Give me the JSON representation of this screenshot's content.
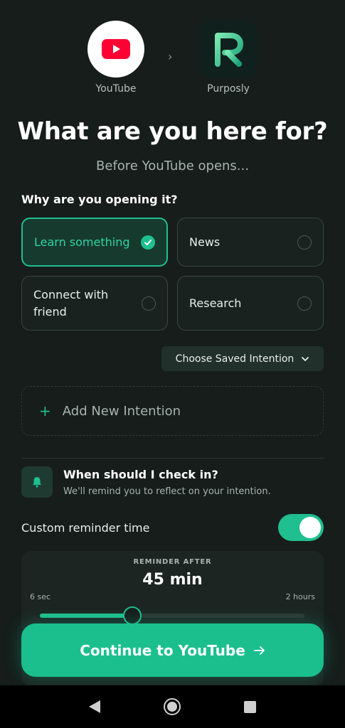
{
  "apps": {
    "source": {
      "label": "YouTube",
      "icon": "youtube-play-icon"
    },
    "separator_icon": "chevron-right-icon",
    "target": {
      "label": "Purposly",
      "icon": "purposly-logo"
    }
  },
  "title": "What are you here for?",
  "subtitle": "Before YouTube opens...",
  "question": "Why are you opening it?",
  "intentions": [
    {
      "label": "Learn something",
      "selected": true
    },
    {
      "label": "News",
      "selected": false
    },
    {
      "label": "Connect with friend",
      "selected": false
    },
    {
      "label": "Research",
      "selected": false
    }
  ],
  "saved_intention": {
    "label": "Choose Saved Intention",
    "icon": "chevron-down-icon"
  },
  "add_intention": {
    "label": "Add New Intention",
    "icon": "plus-icon"
  },
  "check_in": {
    "icon": "bell-icon",
    "title": "When should I check in?",
    "subtitle": "We'll remind you to reflect on your intention."
  },
  "custom_reminder": {
    "label": "Custom reminder time",
    "enabled": true
  },
  "reminder": {
    "label": "REMINDER AFTER",
    "value": "45 min",
    "min_label": "6 sec",
    "max_label": "2 hours",
    "fraction": 0.35
  },
  "cta": {
    "label": "Continue to YouTube",
    "icon": "arrow-right-icon"
  },
  "colors": {
    "accent": "#1fbf8f",
    "background": "#161d1b",
    "youtube_red": "#ff0000"
  },
  "system_nav": {
    "back": "back-icon",
    "home": "home-icon",
    "recents": "recents-icon"
  }
}
